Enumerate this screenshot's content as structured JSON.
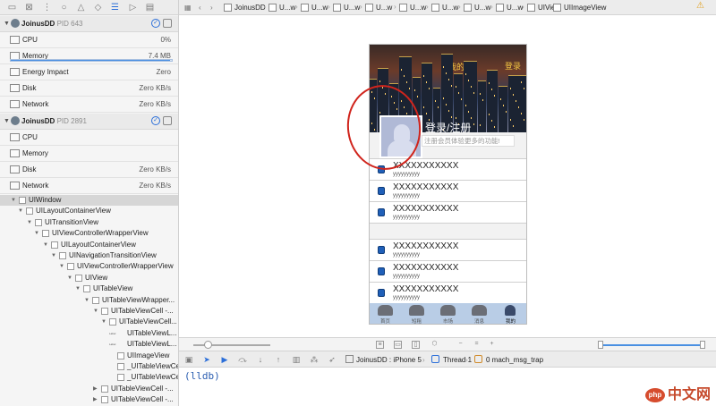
{
  "navigator": {
    "process1": {
      "name": "JoinusDD",
      "pid": "PID 643"
    },
    "gauges1": [
      {
        "label": "CPU",
        "value": "0%"
      },
      {
        "label": "Memory",
        "value": "7.4 MB",
        "fraction": 0.99
      },
      {
        "label": "Energy Impact",
        "value": "Zero"
      },
      {
        "label": "Disk",
        "value": "Zero KB/s"
      },
      {
        "label": "Network",
        "value": "Zero KB/s"
      }
    ],
    "process2": {
      "name": "JoinusDD",
      "pid": "PID 2891"
    },
    "gauges2": [
      {
        "label": "CPU",
        "value": ""
      },
      {
        "label": "Memory",
        "value": ""
      },
      {
        "label": "Disk",
        "value": "Zero KB/s"
      },
      {
        "label": "Network",
        "value": "Zero KB/s"
      }
    ],
    "tree": [
      {
        "label": "UIWindow",
        "small": ""
      },
      {
        "label": "UILayoutContainerView",
        "small": ""
      },
      {
        "label": "UITransitionView",
        "small": ""
      },
      {
        "label": "UIViewControllerWrapperView",
        "small": ""
      },
      {
        "label": "UILayoutContainerView",
        "small": ""
      },
      {
        "label": "UINavigationTransitionView",
        "small": ""
      },
      {
        "label": "UIViewControllerWrapperView",
        "small": ""
      },
      {
        "label": "UIView",
        "small": ""
      },
      {
        "label": "UITableView",
        "small": ""
      },
      {
        "label": "UITableViewWrapper...",
        "small": ""
      },
      {
        "label": "UITableViewCell -...",
        "small": ""
      },
      {
        "label": "UITableViewCell...",
        "small": ""
      },
      {
        "label": "UITableViewL...",
        "small": "Label"
      },
      {
        "label": "UITableViewL...",
        "small": "Label"
      },
      {
        "label": "UIImageView",
        "small": ""
      },
      {
        "label": "_UITableViewCel...",
        "small": ""
      },
      {
        "label": "_UITableViewCel...",
        "small": ""
      },
      {
        "label": "UITableViewCell -...",
        "small": ""
      },
      {
        "label": "UITableViewCell -...",
        "small": ""
      }
    ]
  },
  "jumpbar": {
    "items": [
      "JoinusDD",
      "U...w",
      "U...w",
      "U...w",
      "U...w",
      "U...w",
      "U...w",
      "U...w",
      "U...w",
      "UIView",
      "UIImageView"
    ]
  },
  "phone": {
    "header_left_text": "我的",
    "header_right_text": "登录",
    "register_title": "登录/注册",
    "register_subtitle": "注册会员体验更多的功能!",
    "cells": [
      {
        "title": "XXXXXXXXXXX",
        "subtitle": "yyyyyyyyyy"
      },
      {
        "title": "XXXXXXXXXXX",
        "subtitle": "yyyyyyyyyy"
      },
      {
        "title": "XXXXXXXXXXX",
        "subtitle": "yyyyyyyyyy"
      },
      {
        "title": "XXXXXXXXXXX",
        "subtitle": "yyyyyyyyyy"
      },
      {
        "title": "XXXXXXXXXXX",
        "subtitle": "yyyyyyyyyy"
      },
      {
        "title": "XXXXXXXXXXX",
        "subtitle": "yyyyyyyyyy"
      }
    ],
    "tabs": [
      "首页",
      "短租",
      "市场",
      "消息",
      "我的"
    ]
  },
  "debugbar": {
    "device": "JoinusDD : iPhone 5",
    "thread": "Thread 1",
    "frame": "0 mach_msg_trap"
  },
  "console": {
    "prompt": "(lldb)"
  },
  "watermark": {
    "badge": "php",
    "text": "中文网"
  },
  "colors": {
    "accent": "#2c6fd9",
    "annotation": "#d0241c",
    "tabbar": "#b9cde6"
  }
}
